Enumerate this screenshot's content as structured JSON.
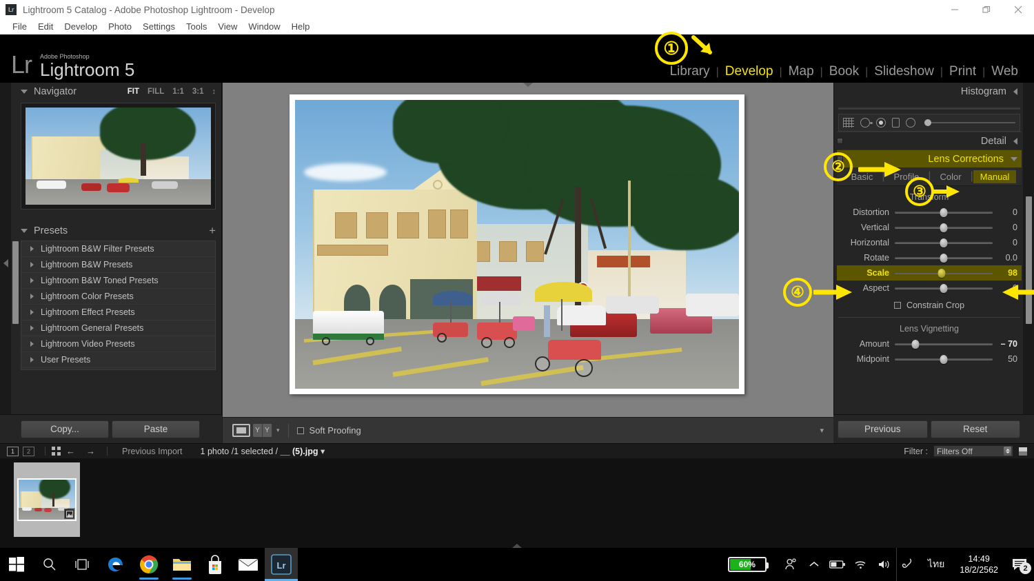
{
  "window": {
    "title": "Lightroom 5 Catalog - Adobe Photoshop Lightroom - Develop",
    "app_badge": "Lr",
    "minimize_label": "Minimize",
    "restore_label": "Restore",
    "close_label": "Close"
  },
  "menubar": {
    "items": [
      "File",
      "Edit",
      "Develop",
      "Photo",
      "Settings",
      "Tools",
      "View",
      "Window",
      "Help"
    ]
  },
  "identity": {
    "logo": "Lr",
    "superline": "Adobe Photoshop",
    "product": "Lightroom 5"
  },
  "modules": {
    "items": [
      {
        "label": "Library",
        "active": false
      },
      {
        "label": "Develop",
        "active": true
      },
      {
        "label": "Map",
        "active": false
      },
      {
        "label": "Book",
        "active": false
      },
      {
        "label": "Slideshow",
        "active": false
      },
      {
        "label": "Print",
        "active": false
      },
      {
        "label": "Web",
        "active": false
      }
    ],
    "separator": "|"
  },
  "navigator": {
    "title": "Navigator",
    "zoom_levels": [
      {
        "label": "FIT",
        "active": true
      },
      {
        "label": "FILL",
        "active": false
      },
      {
        "label": "1:1",
        "active": false
      },
      {
        "label": "3:1",
        "active": false
      }
    ],
    "stepper": "↕"
  },
  "presets": {
    "title": "Presets",
    "add_label": "+",
    "items": [
      "Lightroom B&W Filter Presets",
      "Lightroom B&W Presets",
      "Lightroom B&W Toned Presets",
      "Lightroom Color Presets",
      "Lightroom Effect Presets",
      "Lightroom General Presets",
      "Lightroom Video Presets",
      "User Presets"
    ]
  },
  "left_buttons": {
    "copy": "Copy...",
    "paste": "Paste"
  },
  "toolbar": {
    "soft_proofing": "Soft Proofing",
    "compare_label": "YY",
    "caret": "▾"
  },
  "right_panel": {
    "histogram": {
      "title": "Histogram"
    },
    "detail": {
      "title": "Detail"
    },
    "lens_corrections": {
      "title": "Lens Corrections",
      "tabs": [
        {
          "label": "Basic",
          "selected": false
        },
        {
          "label": "Profile",
          "selected": false
        },
        {
          "label": "Color",
          "selected": false
        },
        {
          "label": "Manual",
          "selected": true
        }
      ],
      "transform": {
        "title": "Transform",
        "sliders": [
          {
            "label": "Distortion",
            "value": "0",
            "pos": 50,
            "highlight": false
          },
          {
            "label": "Vertical",
            "value": "0",
            "pos": 50,
            "highlight": false
          },
          {
            "label": "Horizontal",
            "value": "0",
            "pos": 50,
            "highlight": false
          },
          {
            "label": "Rotate",
            "value": "0.0",
            "pos": 50,
            "highlight": false
          },
          {
            "label": "Scale",
            "value": "98",
            "pos": 48,
            "highlight": true
          },
          {
            "label": "Aspect",
            "value": "0",
            "pos": 50,
            "highlight": false
          }
        ],
        "constrain_crop": "Constrain Crop"
      },
      "lens_vignetting": {
        "title": "Lens Vignetting",
        "sliders": [
          {
            "label": "Amount",
            "value": "– 70",
            "pos": 21,
            "bold": true
          },
          {
            "label": "Midpoint",
            "value": "50",
            "pos": 50,
            "bold": false
          }
        ]
      }
    }
  },
  "right_buttons": {
    "previous": "Previous",
    "reset": "Reset"
  },
  "filmstrip": {
    "view_1": "1",
    "view_2": "2",
    "back_arrow": "←",
    "forward_arrow": "→",
    "source": "Previous Import",
    "status_prefix": "1 photo /1 selected /",
    "filename": "__ (5).jpg",
    "filename_caret": "▾",
    "filter_label": "Filter :",
    "filter_value": "Filters Off"
  },
  "taskbar": {
    "items": [
      {
        "name": "start",
        "running": false,
        "active": false
      },
      {
        "name": "search",
        "running": false,
        "active": false
      },
      {
        "name": "task-view",
        "running": false,
        "active": false
      },
      {
        "name": "edge",
        "running": false,
        "active": false
      },
      {
        "name": "chrome",
        "running": true,
        "active": false
      },
      {
        "name": "file-explorer",
        "running": true,
        "active": false
      },
      {
        "name": "microsoft-store",
        "running": false,
        "active": false
      },
      {
        "name": "mail",
        "running": false,
        "active": false
      },
      {
        "name": "lightroom",
        "running": false,
        "active": true
      }
    ],
    "battery_percent": "60%",
    "language": "ไทย",
    "time": "14:49",
    "date": "18/2/2562",
    "notification_count": "2"
  },
  "annotations": [
    {
      "number": "①",
      "target": "develop-module"
    },
    {
      "number": "②",
      "target": "lens-corrections-header"
    },
    {
      "number": "③",
      "target": "manual-tab"
    },
    {
      "number": "④",
      "target": "scale-slider"
    }
  ],
  "colors": {
    "accent_yellow": "#ffe600",
    "highlight_bg": "#5c5600",
    "panel_bg": "#252525",
    "canvas_bg": "#808080",
    "battery_green": "#1ab41a"
  }
}
